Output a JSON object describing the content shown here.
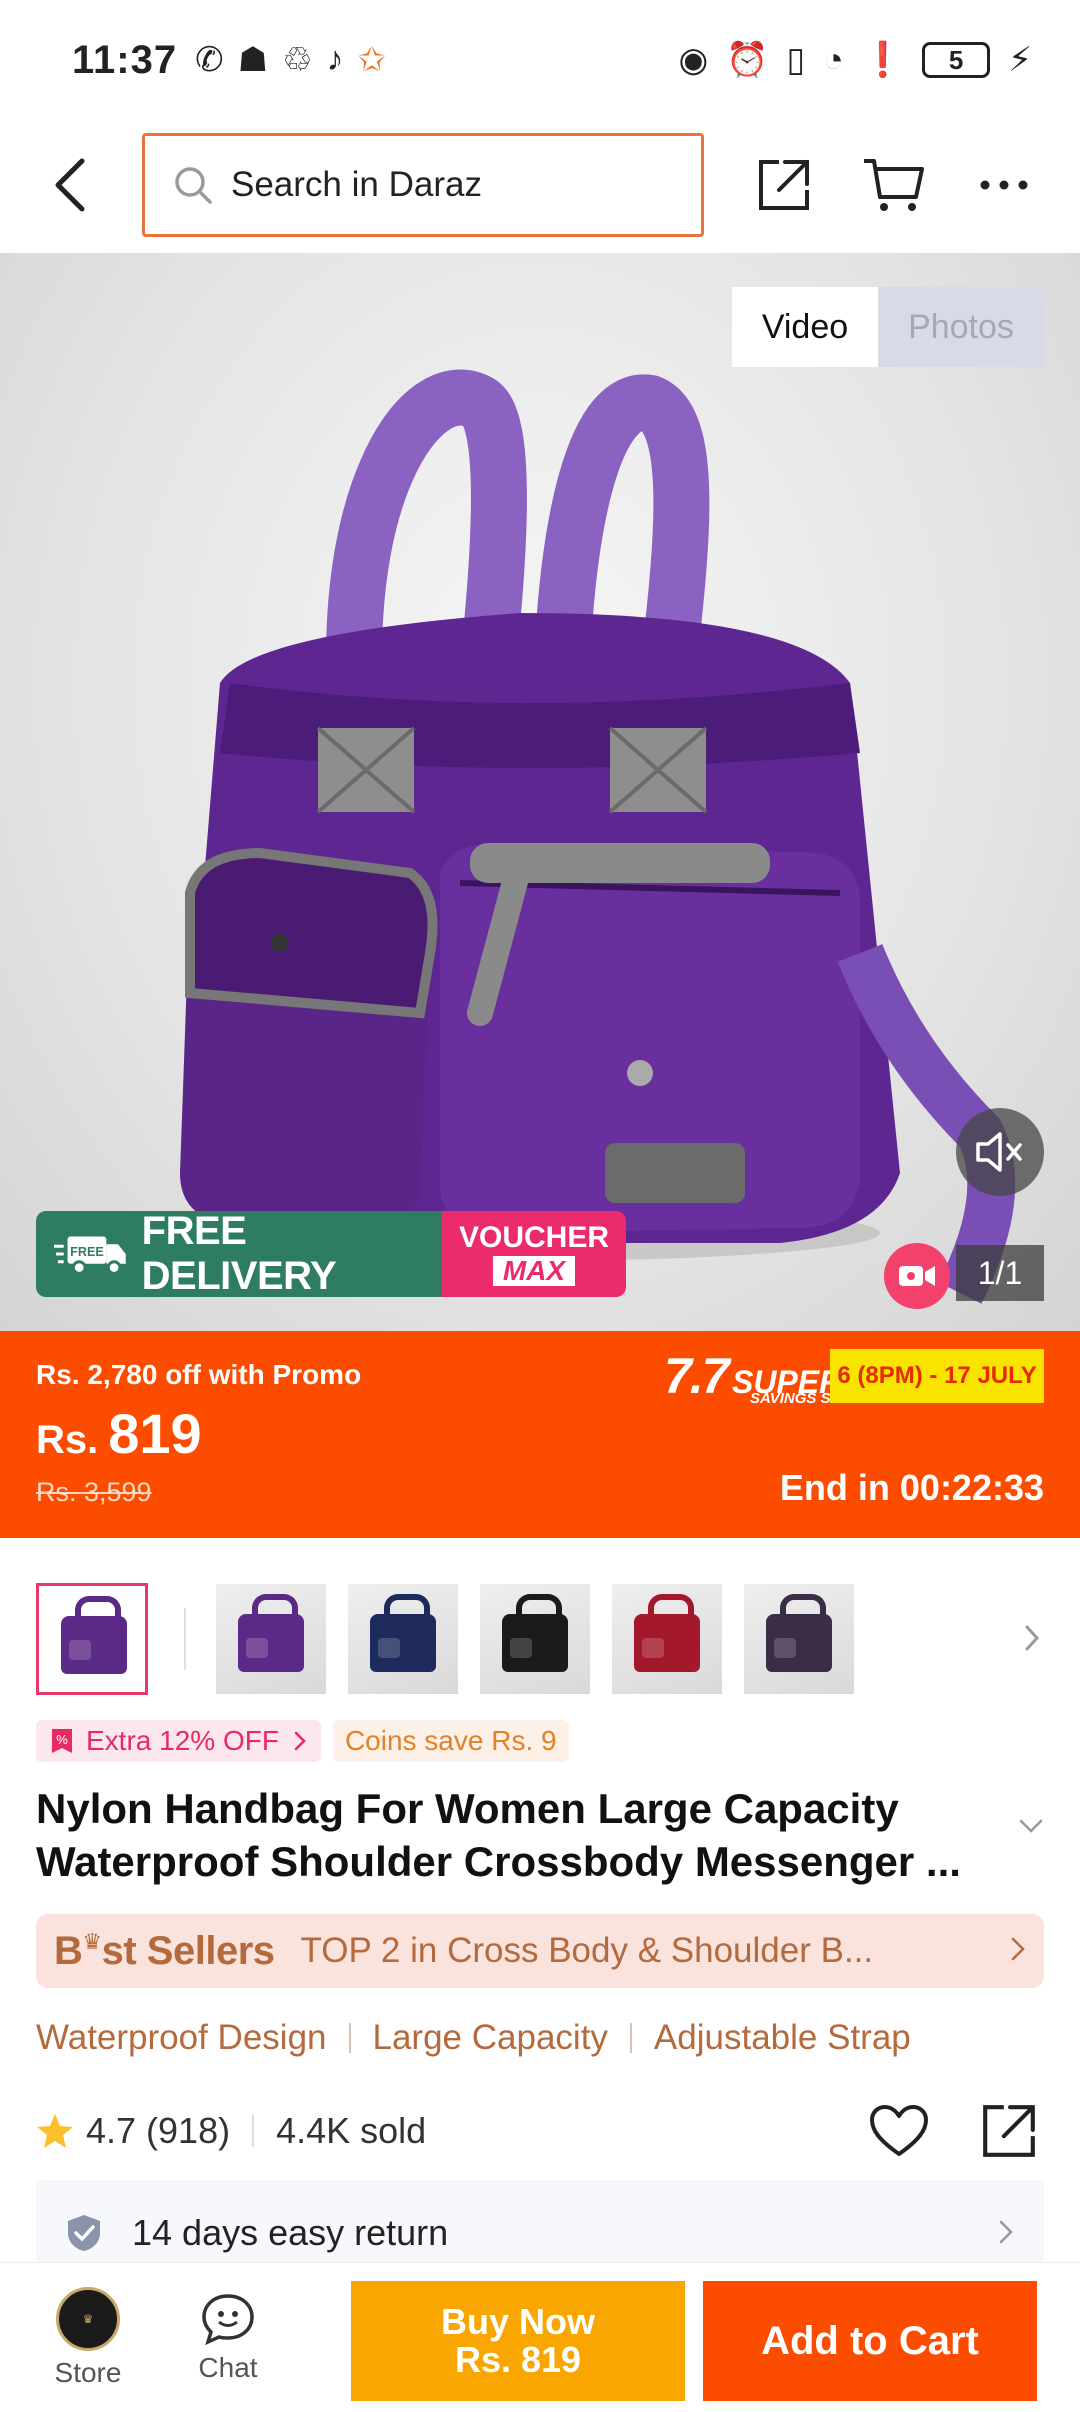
{
  "status_bar": {
    "time": "11:37",
    "battery": "5",
    "icons": [
      "whatsapp-icon",
      "snapchat-icon",
      "recycle-icon",
      "tiktok-icon",
      "star-icon",
      "eye-icon",
      "alarm-icon",
      "vibrate-icon",
      "wifi-icon",
      "alert-icon",
      "battery-icon",
      "charging-icon"
    ]
  },
  "header": {
    "search_placeholder": "Search in Daraz"
  },
  "media": {
    "tab_video": "Video",
    "tab_photos": "Photos",
    "active_tab": "Video",
    "counter": "1/1",
    "promo_free": "FREE DELIVERY",
    "promo_voucher_1": "VOUCHER",
    "promo_voucher_2": "MAX",
    "promo_free_badge": "FREE"
  },
  "price": {
    "promo_text": "Rs. 2,780 off with Promo",
    "currency": "Rs.",
    "current": "819",
    "original": "Rs. 3,599",
    "sale_title_1": "7.7",
    "sale_title_2": "SUPER",
    "sale_title_3": "SAVINGS SALE",
    "sale_dates": "6 (8PM) - 17 JULY",
    "countdown": "End in 00:22:33"
  },
  "thumbnails": [
    {
      "color": "#5b2a86"
    },
    {
      "color": "#5b2a86"
    },
    {
      "color": "#1f2a5c"
    },
    {
      "color": "#1b1b1b"
    },
    {
      "color": "#a3182a"
    },
    {
      "color": "#3a2d46"
    }
  ],
  "badges": {
    "extra_off": "Extra 12% OFF",
    "coins": "Coins save Rs. 9"
  },
  "product": {
    "title_line1": "Nylon Handbag For Women Large Capacity",
    "title_line2": "Waterproof Shoulder Crossbody Messenger ..."
  },
  "best_sellers": {
    "label_1": "B",
    "label_2": "st Sellers",
    "text": "TOP 2 in Cross Body & Shoulder B..."
  },
  "features": [
    "Waterproof Design",
    "Large Capacity",
    "Adjustable Strap"
  ],
  "rating": {
    "score": "4.7",
    "count": "(918)",
    "sold": "4.4K sold"
  },
  "return_policy": "14 days easy return",
  "bottom_bar": {
    "store": "Store",
    "chat": "Chat",
    "buy_now_1": "Buy Now",
    "buy_now_2": "Rs. 819",
    "add_to_cart": "Add to Cart"
  },
  "colors": {
    "accent": "#fb4c00",
    "buy_now": "#f9a600",
    "best_sellers_text": "#b46a3c"
  }
}
